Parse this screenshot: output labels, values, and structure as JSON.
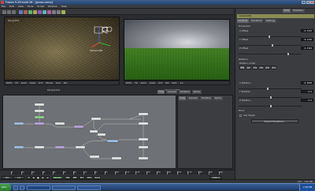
{
  "window": {
    "title": "Fusion 5.26 build 26 - [grass.comp]",
    "controls": [
      "_",
      "□",
      "×"
    ]
  },
  "menu": [
    "File",
    "Edit",
    "View",
    "Tools",
    "Script",
    "Window",
    "Help"
  ],
  "viewer_left": {
    "label": "Perspective",
    "camera_label": "Camera3D1",
    "bar_items": [
      "100%",
      "Fit",
      "SubV",
      "Quad",
      "LUT",
      "Stereo",
      "Grid",
      "RoI"
    ],
    "title": "Merge3D1"
  },
  "viewer_right": {
    "bar_items": [
      "100%",
      "Fit",
      "SubV",
      "Quad",
      "LUT",
      "RoI",
      "DoD",
      "1:1"
    ],
    "title": "Renderer3D1"
  },
  "node_panel": {
    "tabs": [
      "Flow",
      "Console",
      "Timeline",
      "Spline"
    ]
  },
  "right_mid_panel": {
    "tabs": [
      "Flow",
      "Console",
      "Timeline",
      "Spline"
    ]
  },
  "side_panel": {
    "tabs": [
      "Tools",
      "Modifiers"
    ],
    "tool_name": "Camera3D1",
    "tool_tabs": [
      "Controls",
      "Transform",
      "Settings"
    ],
    "translation": {
      "header": "Translation",
      "x_label": "X Offset",
      "x_value": "-0.3476",
      "y_label": "Y Offset",
      "y_value": "0.2136",
      "z_label": "Z Offset",
      "z_value": "6.5329"
    },
    "rotation": {
      "header": "Rotation",
      "order_label": "Rotation Order",
      "orders": [
        "XYZ",
        "XZY",
        "YXZ",
        "YZX",
        "ZXY",
        "ZYX"
      ],
      "x_label": "X Rotation",
      "x_value": "-8.6000",
      "y_label": "Y Rotation",
      "y_value": "0.0",
      "z_label": "Z Rotation",
      "z_value": "0.0"
    },
    "pivot_label": "Pivot",
    "target_label": "Use Target",
    "import_button": "Import Transform..."
  },
  "timeline": {
    "ticks": [
      "0",
      "10",
      "20",
      "30",
      "40",
      "50",
      "60",
      "70",
      "80",
      "90",
      "100",
      "110",
      "120",
      "130",
      "140",
      "150",
      "160",
      "170",
      "180",
      "190",
      "200"
    ],
    "start": "0.0",
    "end": "1000.0",
    "current": "1.0",
    "render_button": "Render",
    "hiq": "HiQ",
    "mb": "MB",
    "prx": "Prx",
    "aprx": "APrx",
    "some": "Some"
  },
  "status": {
    "left": "",
    "right": "12% - 246 MB"
  },
  "taskbar": {
    "start": "start",
    "clock": "2:18 PM"
  },
  "colors": {
    "accent": "#3d5f8d",
    "node_green": "#8fcf8f",
    "node_purple": "#b9a3d8",
    "node_blue": "#9fbfe0",
    "node_white": "#e5e5e5"
  }
}
